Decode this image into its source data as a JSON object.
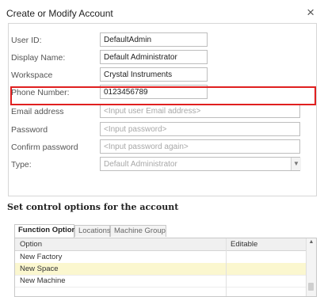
{
  "window": {
    "title": "Create or Modify Account",
    "close_glyph": "×"
  },
  "form": {
    "fields": [
      {
        "label": "User ID:",
        "value": "DefaultAdmin",
        "placeholder": false
      },
      {
        "label": "Display Name:",
        "value": "Default Administrator",
        "placeholder": false
      },
      {
        "label": "Workspace",
        "value": "Crystal Instruments",
        "placeholder": false
      },
      {
        "label": "Phone Number:",
        "value": "0123456789",
        "placeholder": false
      },
      {
        "label": "Email address",
        "value": "<Input user Email address>",
        "placeholder": true
      },
      {
        "label": "Password",
        "value": "<Input password>",
        "placeholder": true
      },
      {
        "label": "Confirm password",
        "value": "<Input password again>",
        "placeholder": true
      },
      {
        "label": "Type:",
        "value": "Default Administrator",
        "placeholder": false
      }
    ]
  },
  "section": {
    "title": "Set control options for the account"
  },
  "tabs": [
    "Function Option",
    "Locations",
    "Machine Group"
  ],
  "grid": {
    "columns": [
      "Option",
      "Editable"
    ],
    "rows": [
      "New Factory",
      "New Space",
      "New Machine"
    ]
  },
  "colors": {
    "highlight": "#e02020",
    "selected_row": "#fbf7cf"
  },
  "icons": {
    "close": "close-icon",
    "dropdown": "chevron-down-icon",
    "scroll_up": "chevron-up-icon"
  }
}
